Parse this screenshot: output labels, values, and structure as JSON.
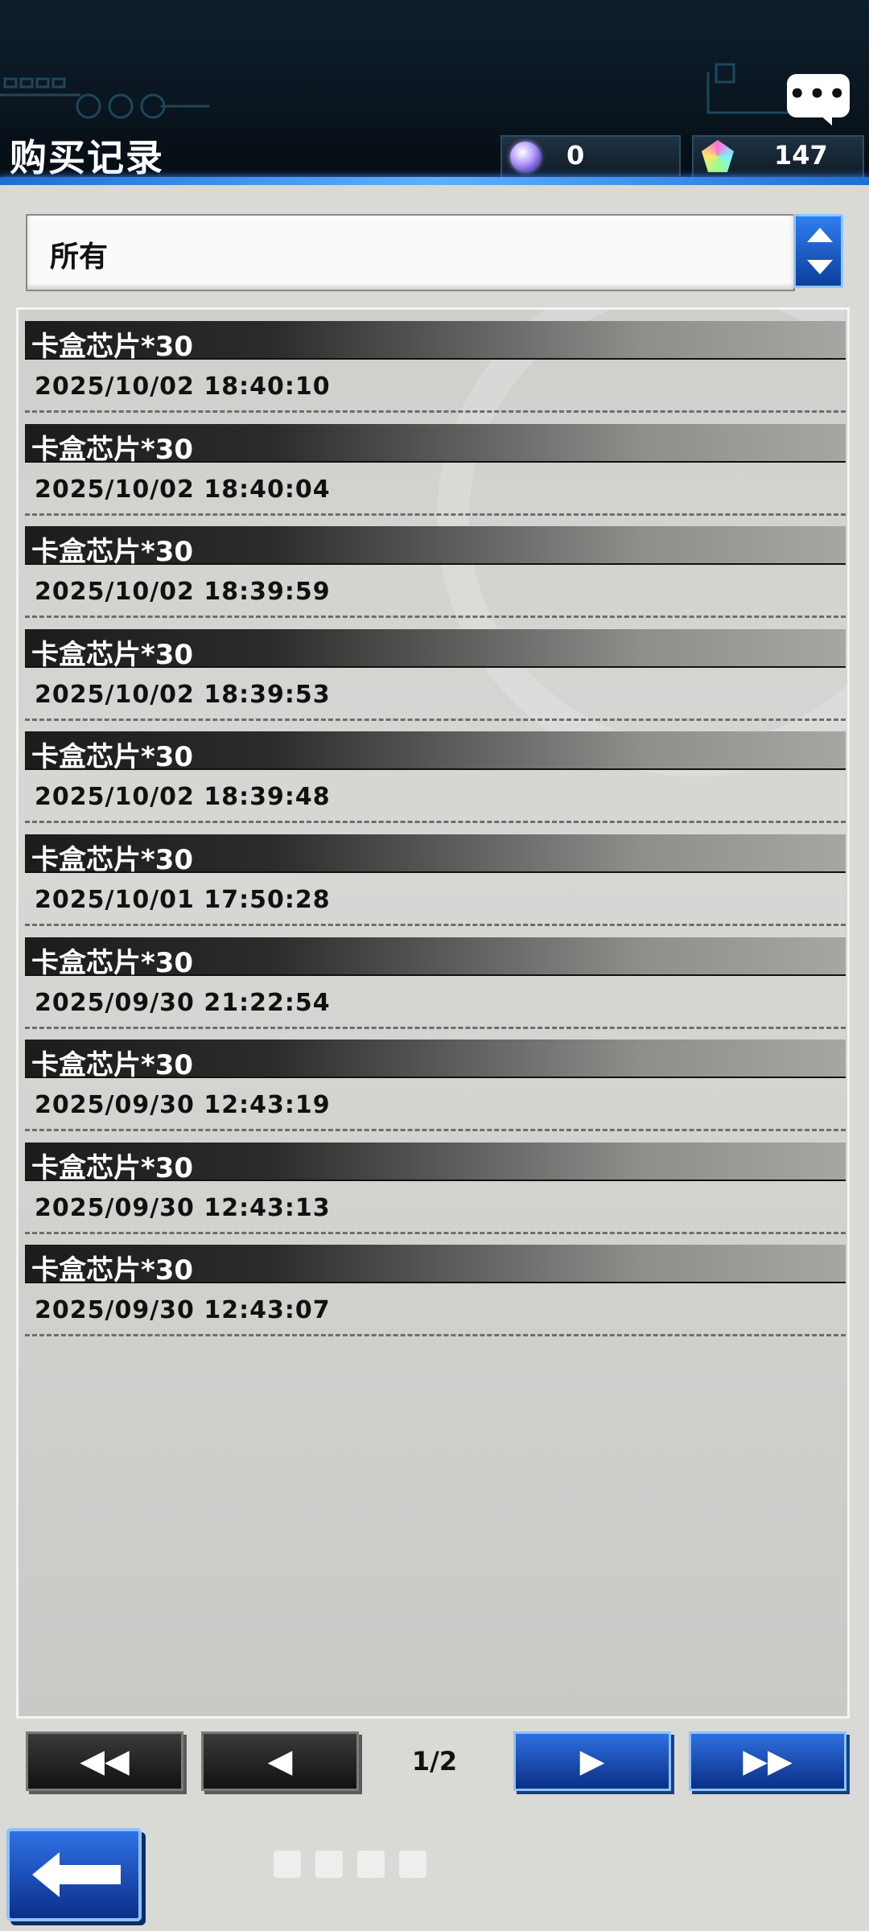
{
  "header": {
    "title": "购买记录",
    "currency_orb": "0",
    "currency_gem": "147",
    "chat_icon_glyph": "•••"
  },
  "filter": {
    "selected": "所有"
  },
  "records": [
    {
      "item": "卡盒芯片*30",
      "time": "2025/10/02 18:40:10"
    },
    {
      "item": "卡盒芯片*30",
      "time": "2025/10/02 18:40:04"
    },
    {
      "item": "卡盒芯片*30",
      "time": "2025/10/02 18:39:59"
    },
    {
      "item": "卡盒芯片*30",
      "time": "2025/10/02 18:39:53"
    },
    {
      "item": "卡盒芯片*30",
      "time": "2025/10/02 18:39:48"
    },
    {
      "item": "卡盒芯片*30",
      "time": "2025/10/01 17:50:28"
    },
    {
      "item": "卡盒芯片*30",
      "time": "2025/09/30 21:22:54"
    },
    {
      "item": "卡盒芯片*30",
      "time": "2025/09/30 12:43:19"
    },
    {
      "item": "卡盒芯片*30",
      "time": "2025/09/30 12:43:13"
    },
    {
      "item": "卡盒芯片*30",
      "time": "2025/09/30 12:43:07"
    }
  ],
  "pager": {
    "first_glyph": "◀◀",
    "prev_glyph": "◀",
    "next_glyph": "▶",
    "last_glyph": "▶▶",
    "page_indicator": "1/2"
  },
  "colors": {
    "accent_blue": "#2d6fe0",
    "header_dark": "#0a1620",
    "record_bar": "#1c1c1c"
  }
}
